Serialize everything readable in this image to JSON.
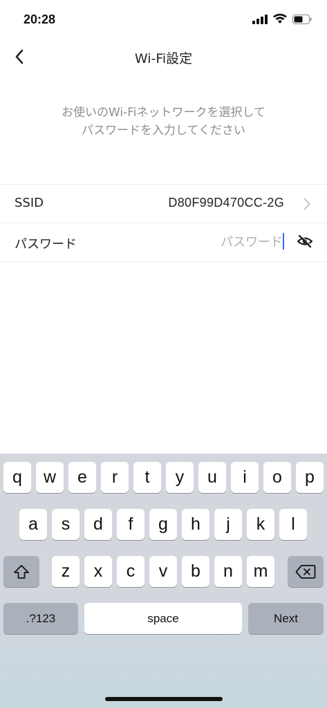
{
  "status": {
    "time": "20:28"
  },
  "nav": {
    "title": "Wi-Fi設定"
  },
  "instruction": {
    "line1": "お使いのWi-Fiネットワークを選択して",
    "line2": "パスワードを入力してください"
  },
  "form": {
    "ssid_label": "SSID",
    "ssid_value": "D80F99D470CC-2G",
    "password_label": "パスワード",
    "password_placeholder": "パスワード",
    "password_value": ""
  },
  "keyboard": {
    "row1": [
      "q",
      "w",
      "e",
      "r",
      "t",
      "y",
      "u",
      "i",
      "o",
      "p"
    ],
    "row2": [
      "a",
      "s",
      "d",
      "f",
      "g",
      "h",
      "j",
      "k",
      "l"
    ],
    "row3": [
      "z",
      "x",
      "c",
      "v",
      "b",
      "n",
      "m"
    ],
    "numbers_label": ".?123",
    "space_label": "space",
    "next_label": "Next"
  },
  "icons": {
    "back": "chevron-left-icon",
    "ssid_arrow": "chevron-right-icon",
    "visibility": "eye-off-icon",
    "shift": "shift-icon",
    "delete": "backspace-icon"
  },
  "colors": {
    "caret": "#2f6bff",
    "placeholder": "#b0b0b0",
    "instruction": "#8e8e8e"
  }
}
